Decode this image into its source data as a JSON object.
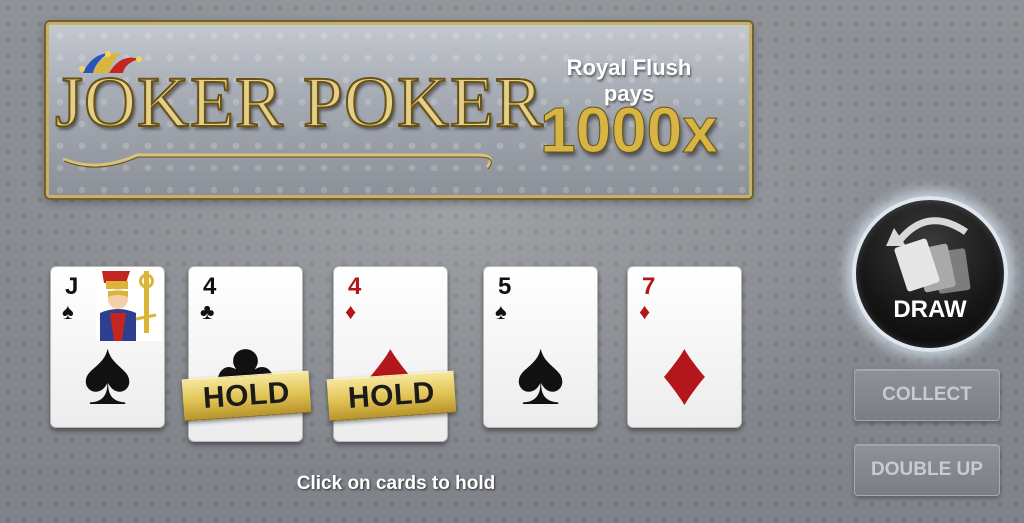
{
  "banner": {
    "logo_text": "JOKER POKER",
    "payout_label": "Royal Flush pays",
    "payout_value": "1000x"
  },
  "cards": [
    {
      "rank": "J",
      "suit": "spades",
      "suit_symbol": "♠",
      "color": "black",
      "held": false,
      "hold_label": ""
    },
    {
      "rank": "4",
      "suit": "clubs",
      "suit_symbol": "♣",
      "color": "black",
      "held": true,
      "hold_label": "HOLD"
    },
    {
      "rank": "4",
      "suit": "diamonds",
      "suit_symbol": "♦",
      "color": "red",
      "held": true,
      "hold_label": "HOLD"
    },
    {
      "rank": "5",
      "suit": "spades",
      "suit_symbol": "♠",
      "color": "black",
      "held": false,
      "hold_label": ""
    },
    {
      "rank": "7",
      "suit": "diamonds",
      "suit_symbol": "♦",
      "color": "red",
      "held": false,
      "hold_label": ""
    }
  ],
  "hint": "Click on cards to hold",
  "buttons": {
    "draw": "DRAW",
    "collect": "COLLECT",
    "double_up": "DOUBLE UP"
  },
  "colors": {
    "gold": "#d6b446",
    "red_suit": "#b3161b",
    "black_suit": "#111111"
  },
  "icons": {
    "draw_icon": "cards-redraw-icon",
    "jester_hat": "jester-hat-icon"
  }
}
